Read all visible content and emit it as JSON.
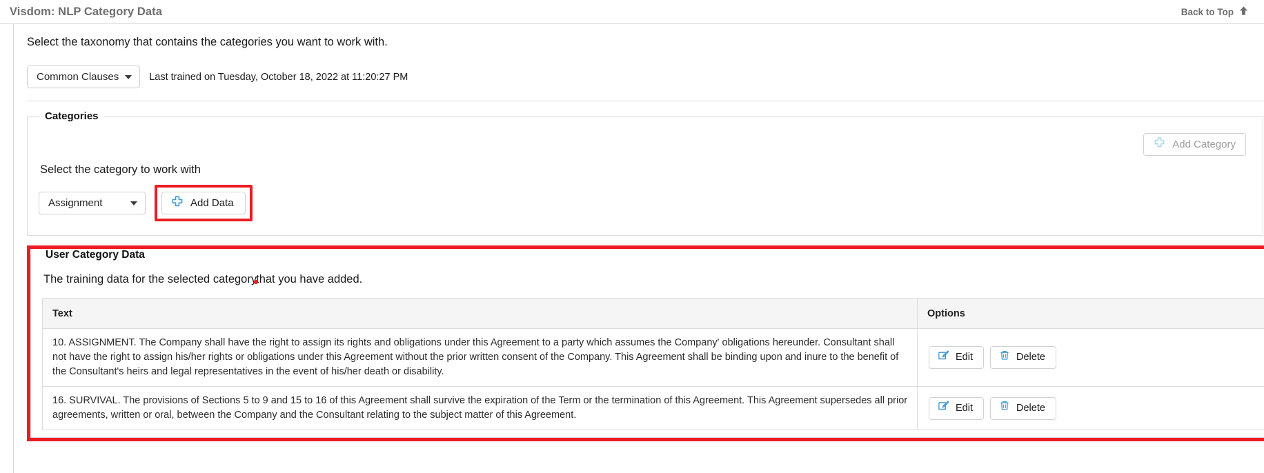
{
  "topbar": {
    "title": "Visdom: NLP Category Data",
    "back_to_top": "Back to Top",
    "arrow_icon": "arrow-up-icon"
  },
  "taxonomy": {
    "instruction": "Select the taxonomy that contains the categories you want to work with.",
    "selected": "Common Clauses",
    "last_trained": "Last trained on Tuesday, October 18, 2022 at 11:20:27 PM"
  },
  "categories": {
    "legend": "Categories",
    "add_category_label": "Add Category",
    "add_category_icon": "plus-icon",
    "add_category_disabled": true,
    "select_label": "Select the category to work with",
    "selected_category": "Assignment",
    "add_data_label": "Add Data",
    "add_data_icon": "plus-icon"
  },
  "user_category_data": {
    "legend": "User Category Data",
    "description_before": "The training data for the selected category",
    "description_after": "that you have added.",
    "table": {
      "columns": [
        "Text",
        "Options"
      ],
      "rows": [
        {
          "text": "10. ASSIGNMENT. The Company shall have the right to assign its rights and obligations under this Agreement to a party which assumes the Company' obligations hereunder. Consultant shall not have the right to assign his/her rights or obligations under this Agreement without the prior written consent of the Company. This Agreement shall be binding upon and inure to the benefit of the Consultant's heirs and legal representatives in the event of his/her death or disability.",
          "edit_label": "Edit",
          "edit_icon": "pencil-square-icon",
          "delete_label": "Delete",
          "delete_icon": "trash-icon"
        },
        {
          "text": "16. SURVIVAL. The provisions of Sections 5 to 9 and 15 to 16 of this Agreement shall survive the expiration of the Term or the termination of this Agreement. This Agreement supersedes all prior agreements, written or oral, between the Company and the Consultant relating to the subject matter of this Agreement.",
          "edit_label": "Edit",
          "edit_icon": "pencil-square-icon",
          "delete_label": "Delete",
          "delete_icon": "trash-icon"
        }
      ]
    }
  },
  "colors": {
    "highlight_red": "#ec1c24",
    "icon_blue": "#3f9ad6",
    "icon_blue_light": "#a9d4ef",
    "title_gray": "#6d6d6d"
  }
}
